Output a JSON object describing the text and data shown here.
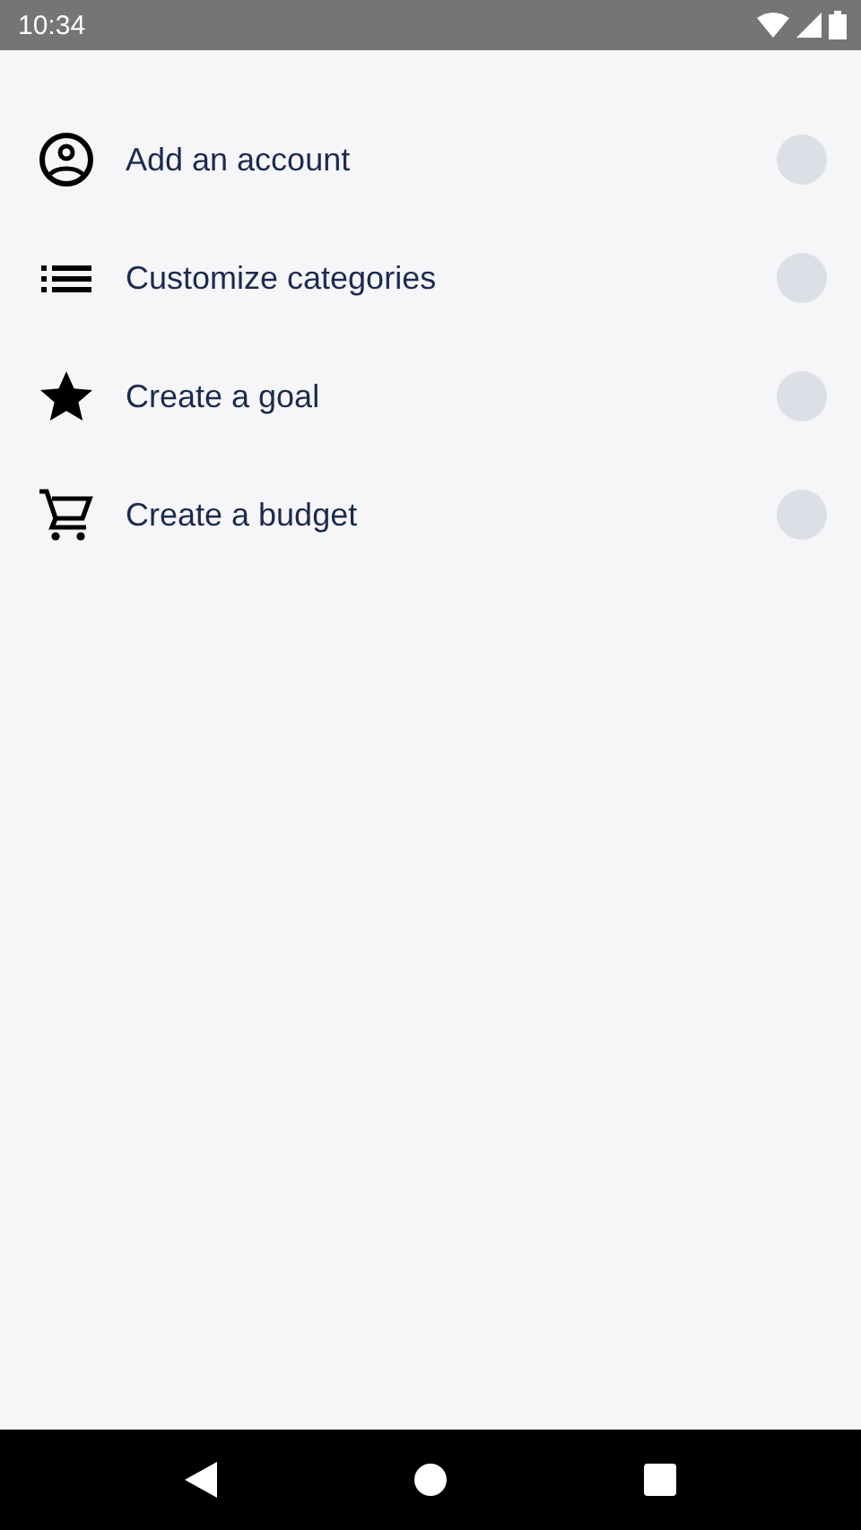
{
  "status_bar": {
    "time": "10:34"
  },
  "tasks": [
    {
      "kind": "account",
      "label": "Add an account",
      "checked": false
    },
    {
      "kind": "list",
      "label": "Customize categories",
      "checked": false
    },
    {
      "kind": "star",
      "label": "Create a goal",
      "checked": false
    },
    {
      "kind": "cart",
      "label": "Create a budget",
      "checked": false
    }
  ]
}
